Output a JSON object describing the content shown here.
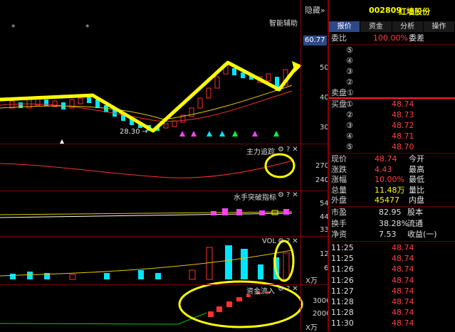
{
  "toolbar": {
    "hide_label": "隐藏",
    "hide_arrows": "»"
  },
  "stock": {
    "code": "002809",
    "name": "红墙股份"
  },
  "tabs": [
    {
      "label": "报价",
      "active": true
    },
    {
      "label": "资金",
      "active": false
    },
    {
      "label": "分析",
      "active": false
    },
    {
      "label": "操作",
      "active": false
    }
  ],
  "main_panel": {
    "title": "智能辅助",
    "price_tag": "60.77",
    "axis": [
      "50",
      "40",
      "30"
    ],
    "low_label": "28.30",
    "stars": [
      "*",
      "*"
    ]
  },
  "indicator1": {
    "title": "主力追踪",
    "axis": [
      "270",
      "240"
    ]
  },
  "indicator2": {
    "title": "水手突破指标",
    "axis": [
      "54",
      "44",
      "33"
    ]
  },
  "indicator3": {
    "title": "VOL",
    "axis": [
      "12",
      "6"
    ],
    "unit": "X万"
  },
  "indicator4": {
    "title": "资金流入",
    "axis": [
      "3000",
      "2000"
    ],
    "unit": "X万"
  },
  "icons": {
    "gear": "⚙",
    "question": "?",
    "close": "✕"
  },
  "order_book": {
    "ratio_label": "委比",
    "ratio_value": "100.00%",
    "diff_label": "委差",
    "sell_levels": [
      "⑤",
      "④",
      "③",
      "②"
    ],
    "sell_label": "卖盘①",
    "buy_label": "买盘",
    "buys": [
      {
        "num": "①",
        "price": "48.74"
      },
      {
        "num": "②",
        "price": "48.73"
      },
      {
        "num": "③",
        "price": "48.72"
      },
      {
        "num": "④",
        "price": "48.71"
      },
      {
        "num": "⑤",
        "price": "48.70"
      }
    ]
  },
  "stats": {
    "rows": [
      {
        "l1": "现价",
        "v1": "48.74",
        "c1": "red",
        "l2": "今开",
        "v2": "",
        "c2": "white"
      },
      {
        "l1": "涨跌",
        "v1": "4.43",
        "c1": "red",
        "l2": "最高",
        "v2": "",
        "c2": "white"
      },
      {
        "l1": "涨幅",
        "v1": "10.00%",
        "c1": "red",
        "l2": "最低",
        "v2": "",
        "c2": "white"
      },
      {
        "l1": "总量",
        "v1": "11.48万",
        "c1": "yellow",
        "l2": "量比",
        "v2": "",
        "c2": "white"
      },
      {
        "l1": "外盘",
        "v1": "45477",
        "c1": "yellow",
        "l2": "内盘",
        "v2": "",
        "c2": "white"
      }
    ],
    "rows2": [
      {
        "l1": "市盈",
        "v1": "82.95",
        "l2": "股本"
      },
      {
        "l1": "换手",
        "v1": "38.28%",
        "l2": "流通"
      },
      {
        "l1": "净资",
        "v1": "7.53",
        "l2": "收益(一)"
      }
    ]
  },
  "ticks": [
    {
      "time": "11:25",
      "price": "48.74"
    },
    {
      "time": "11:25",
      "price": "48.74"
    },
    {
      "time": "11:26",
      "price": "48.74"
    },
    {
      "time": "11:26",
      "price": "48.74"
    },
    {
      "time": "11:27",
      "price": "48.74"
    },
    {
      "time": "11:28",
      "price": "48.74"
    },
    {
      "time": "11:28",
      "price": "48.74"
    },
    {
      "time": "11:30",
      "price": "48.74"
    }
  ],
  "colors": {
    "up": "#ff3030",
    "down": "#00e5ff",
    "accent": "#ffff00",
    "border": "#8b0000"
  }
}
